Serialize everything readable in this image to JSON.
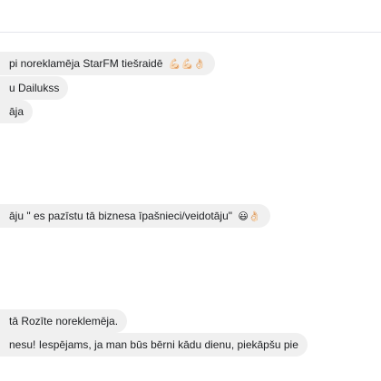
{
  "messages": [
    {
      "text": "pi noreklamēja StarFM tiešraidē",
      "emoji": "💪🏻💪🏻👌🏻"
    },
    {
      "text": "u Dailukss",
      "emoji": ""
    },
    {
      "text": "āja",
      "emoji": ""
    },
    {
      "text": "āju \" es pazīstu tā biznesa īpašnieci/veidotāju\"",
      "emoji": "😃👌🏻"
    },
    {
      "text": "tā Rozīte noreklemēja.",
      "emoji": ""
    },
    {
      "text": "nesu! Iespējams, ja man būs bērni kādu dienu, piekāpšu pie",
      "emoji": ""
    }
  ],
  "colors": {
    "bubble_bg": "#f0f0f0",
    "text": "#1c1e21",
    "divider": "#e4e6eb"
  }
}
